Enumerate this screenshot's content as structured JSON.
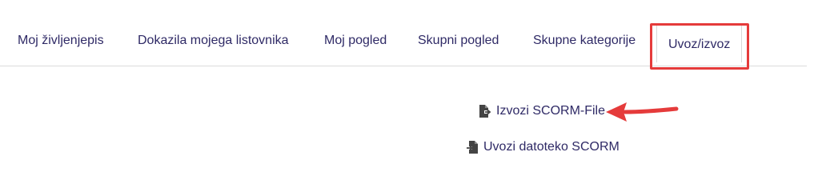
{
  "tabs": [
    {
      "label": "Moj življenjepis"
    },
    {
      "label": "Dokazila mojega listovnika"
    },
    {
      "label": "Moj pogled"
    },
    {
      "label": "Skupni pogled"
    },
    {
      "label": "Skupne kategorije"
    },
    {
      "label": "Uvoz/izvoz",
      "active": true
    }
  ],
  "actions": {
    "export_label": "Izvozi SCORM-File",
    "import_label": "Uvozi datoteko SCORM"
  },
  "icons": {
    "export": "file-export-icon",
    "import": "file-import-icon"
  },
  "colors": {
    "link": "#2f2a66",
    "highlight": "#e53b3b",
    "icon": "#444444"
  }
}
